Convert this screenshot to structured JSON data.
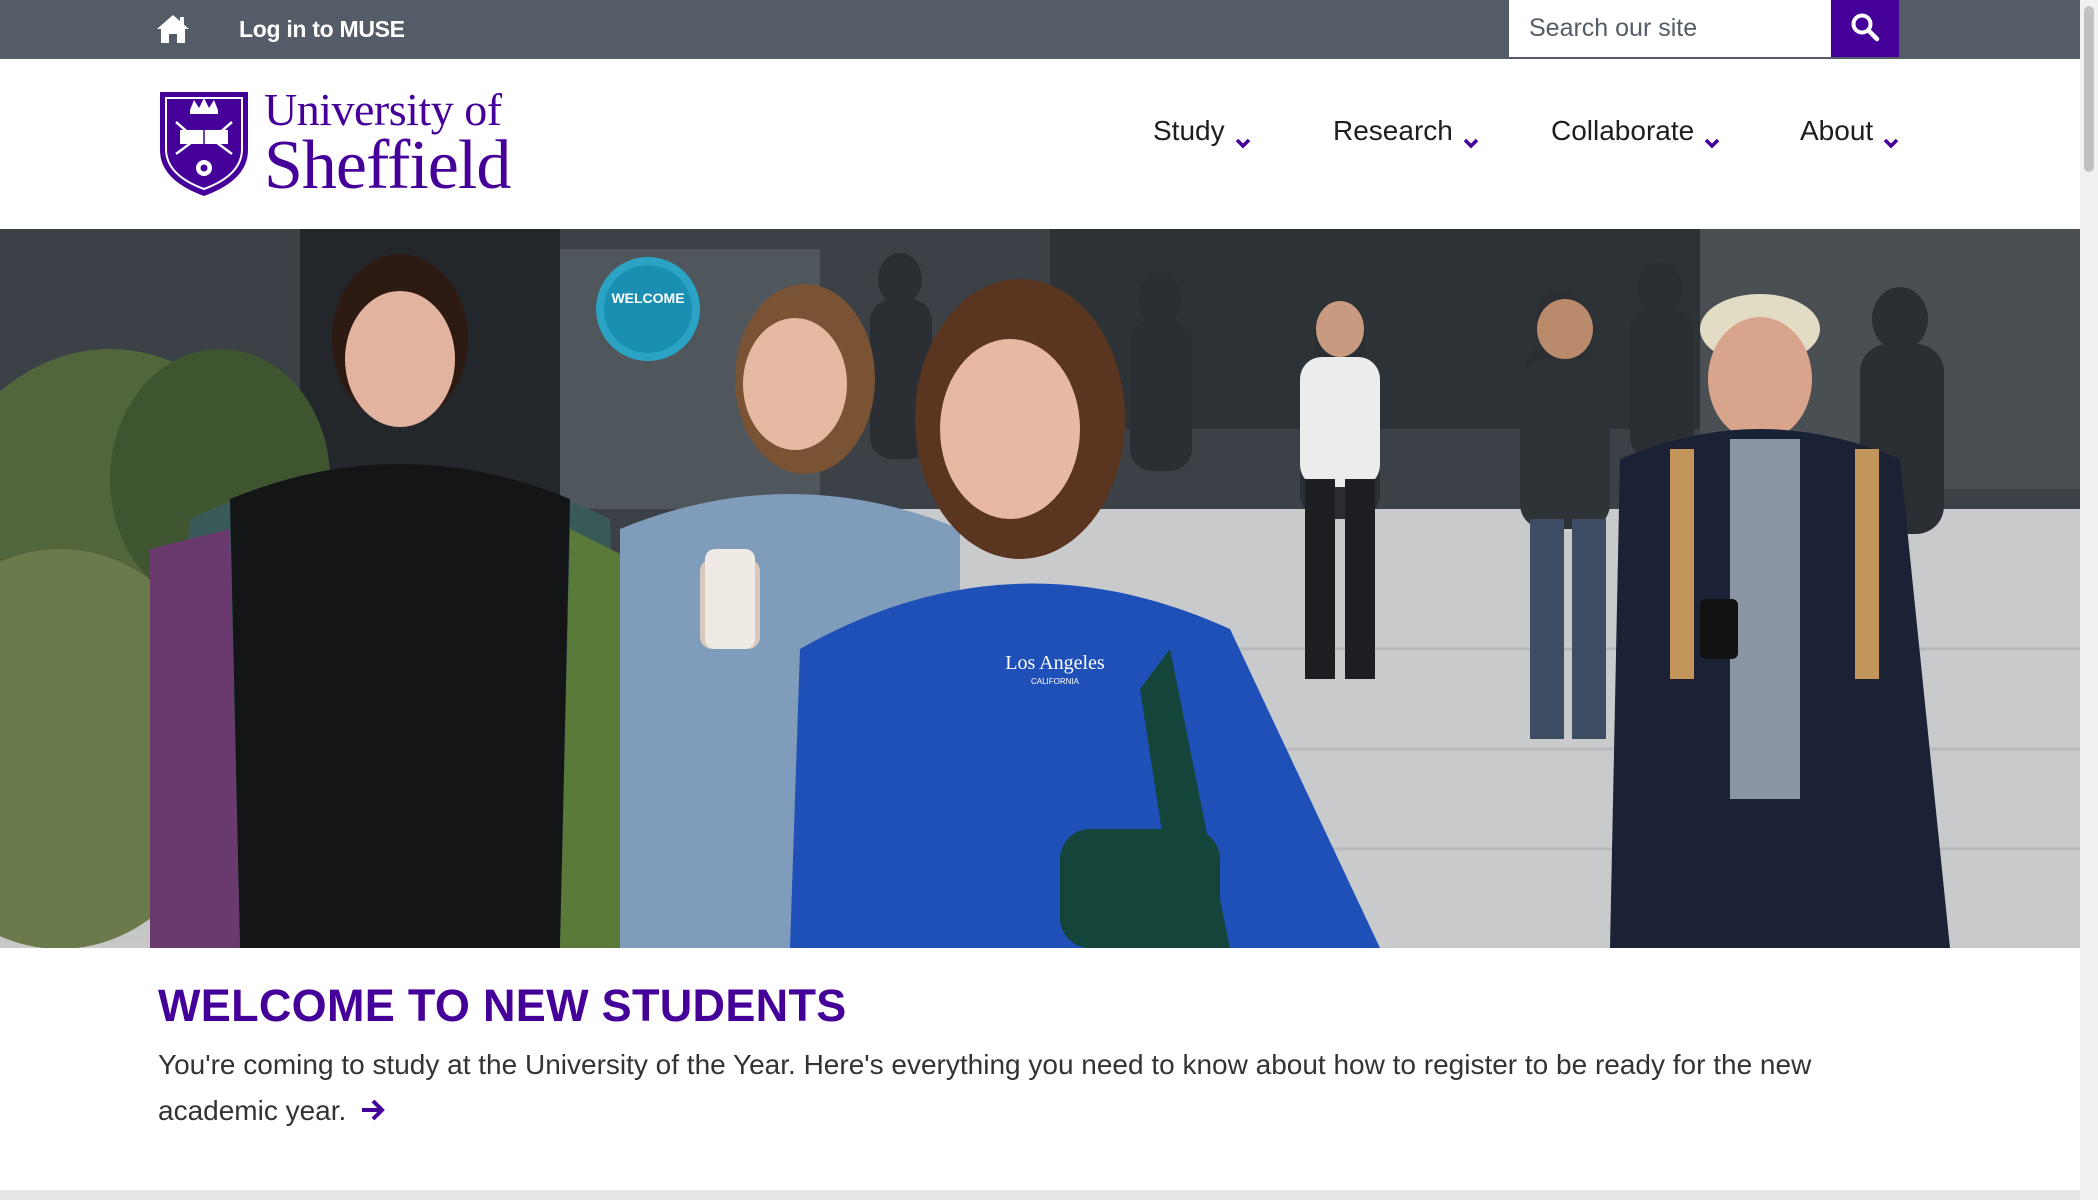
{
  "utility": {
    "home_icon": "home-icon",
    "login_link": "Log in to MUSE",
    "search_placeholder": "Search our site",
    "search_icon": "search-icon"
  },
  "header": {
    "logo_line1": "University of",
    "logo_line2": "Sheffield",
    "nav": [
      {
        "label": "Study",
        "icon": "chevron-down-icon"
      },
      {
        "label": "Research",
        "icon": "chevron-down-icon"
      },
      {
        "label": "Collaborate",
        "icon": "chevron-down-icon"
      },
      {
        "label": "About",
        "icon": "chevron-down-icon"
      }
    ]
  },
  "hero": {
    "sweatshirt_text": "Los Angeles",
    "sweatshirt_subtext": "CALIFORNIA",
    "sign_text": "WELCOME"
  },
  "welcome": {
    "title": "WELCOME TO NEW STUDENTS",
    "text": "You're coming to study at the University of the Year. Here's everything you need to know about how to register to be ready for the new academic year.",
    "arrow_icon": "arrow-right-icon"
  },
  "colors": {
    "brand_purple": "#440099",
    "utility_bar": "#545d67"
  }
}
